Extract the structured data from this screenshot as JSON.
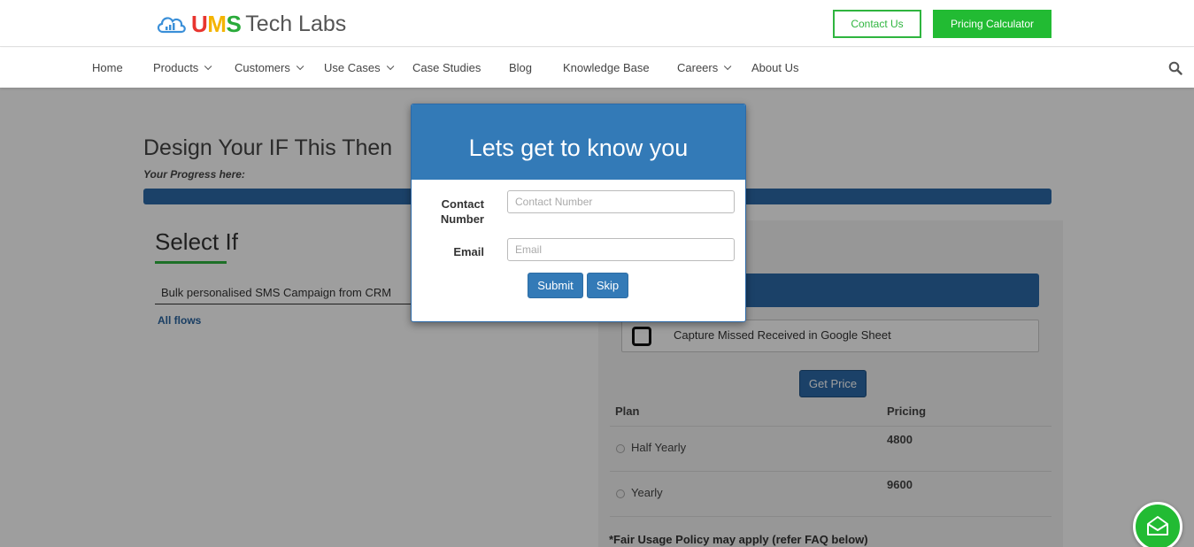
{
  "header": {
    "logo_brand": "UMS",
    "logo_tail": "Tech Labs",
    "contact_button": "Contact Us",
    "pricing_button": "Pricing Calculator"
  },
  "nav": {
    "items": [
      {
        "label": "Home",
        "dropdown": false
      },
      {
        "label": "Products",
        "dropdown": true
      },
      {
        "label": "Customers",
        "dropdown": true
      },
      {
        "label": "Use Cases",
        "dropdown": true
      },
      {
        "label": "Case Studies",
        "dropdown": false
      },
      {
        "label": "Blog",
        "dropdown": false
      },
      {
        "label": "Knowledge Base",
        "dropdown": false
      },
      {
        "label": "Careers",
        "dropdown": true
      },
      {
        "label": "About Us",
        "dropdown": false
      }
    ],
    "search_icon": "search-icon"
  },
  "main": {
    "title": "Design Your IF This Then",
    "progress_label": "Your Progress here:",
    "progress_fraction": 1.0,
    "select_heading": "Select If",
    "flow_value": "Bulk personalised SMS Campaign from CRM",
    "all_flows_link": "All flows"
  },
  "pricing": {
    "capture_label": "Capture Missed Received in Google Sheet",
    "get_price_button": "Get Price",
    "col_plan": "Plan",
    "col_pricing": "Pricing",
    "plans": [
      {
        "name": "Half Yearly",
        "price": "4800"
      },
      {
        "name": "Yearly",
        "price": "9600"
      }
    ],
    "policy_note": "*Fair Usage Policy may apply (refer FAQ below)"
  },
  "modal": {
    "title": "Lets get to know you",
    "contact_label": "Contact Number",
    "contact_placeholder": "Contact Number",
    "contact_value": "",
    "email_label": "Email",
    "email_placeholder": "Email",
    "email_value": "",
    "submit_button": "Submit",
    "skip_button": "Skip"
  },
  "colors": {
    "accent_green": "#22bb33",
    "primary_blue": "#337ab7",
    "progress_blue": "#2d6aa8"
  }
}
